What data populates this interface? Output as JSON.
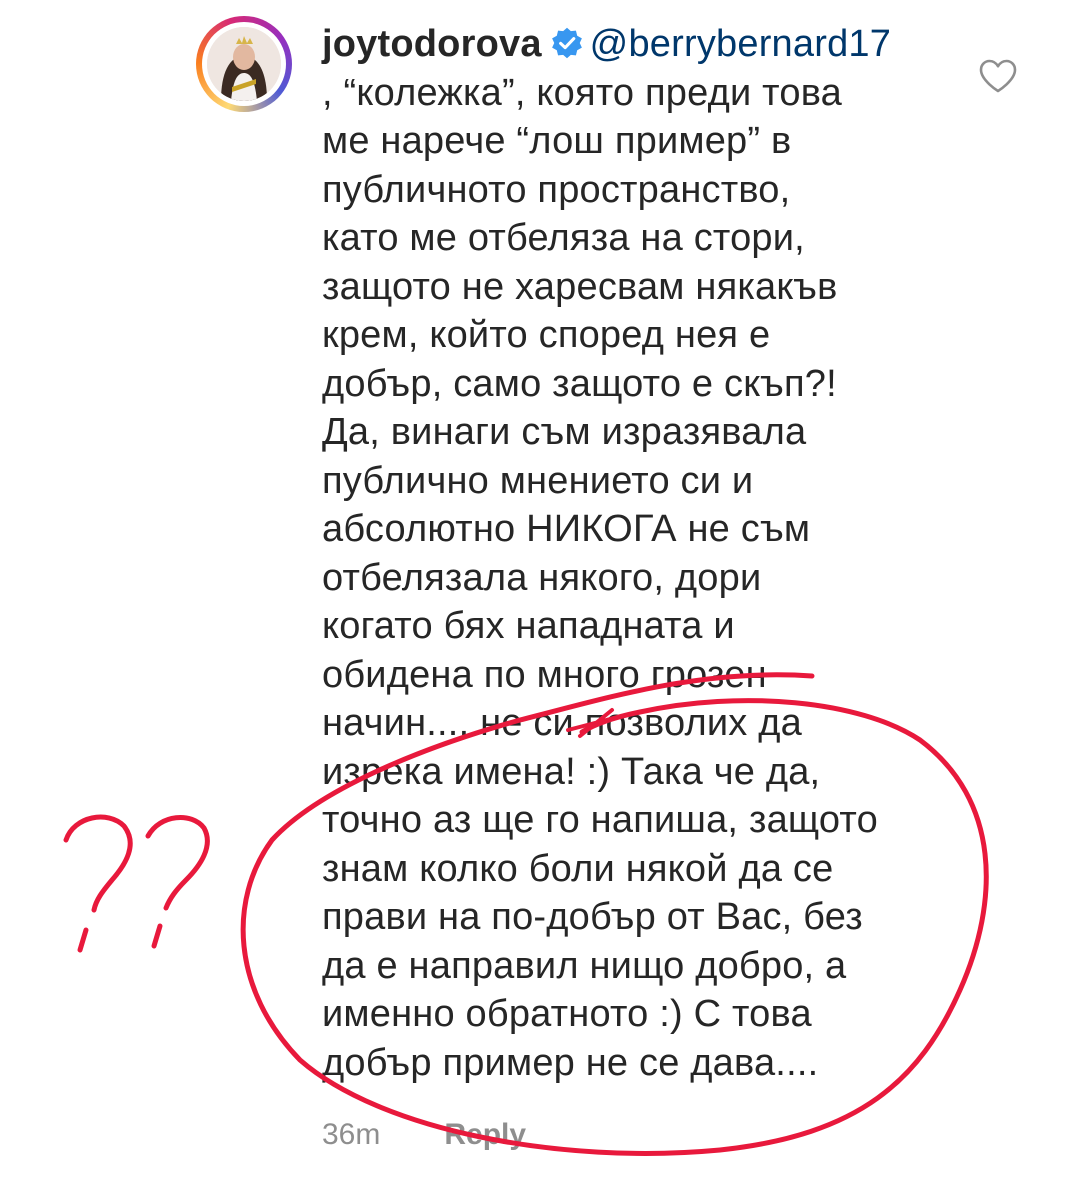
{
  "comment": {
    "username": "joytodorova",
    "mention": "@berrybernard17",
    "lines": [
      ", “колежка”, която преди това",
      "ме нарече “лош пример” в",
      "публичното пространство,",
      "като ме отбеляза на стори,",
      "защото не харесвам някакъв",
      "крем, който според нея е",
      "добър, само защото е скъп?!",
      "Да, винаги съм изразявала",
      "публично мнението си и",
      "абсолютно НИКОГА не съм",
      "отбелязала някого, дори",
      "когато бях нападната и",
      "обидена по много грозен",
      "начин.... не си позволих да",
      "изрека имена! :) Така че да,",
      "точно аз ще го напиша, защото",
      "знам колко боли някой да се",
      "прави на по-добър от Вас, без",
      "да е направил нищо добро, а",
      "именно обратното :) С това",
      "добър пример не се дава...."
    ],
    "time": "36m",
    "reply_label": "Reply"
  },
  "icons": {
    "verified": "verified-badge-icon",
    "like": "heart-outline-icon"
  },
  "colors": {
    "text": "#262626",
    "mention": "#00376b",
    "verified": "#3897f0",
    "meta": "#8e8e8e",
    "annotation": "#e8193c"
  },
  "annotation": {
    "marks": "??"
  }
}
